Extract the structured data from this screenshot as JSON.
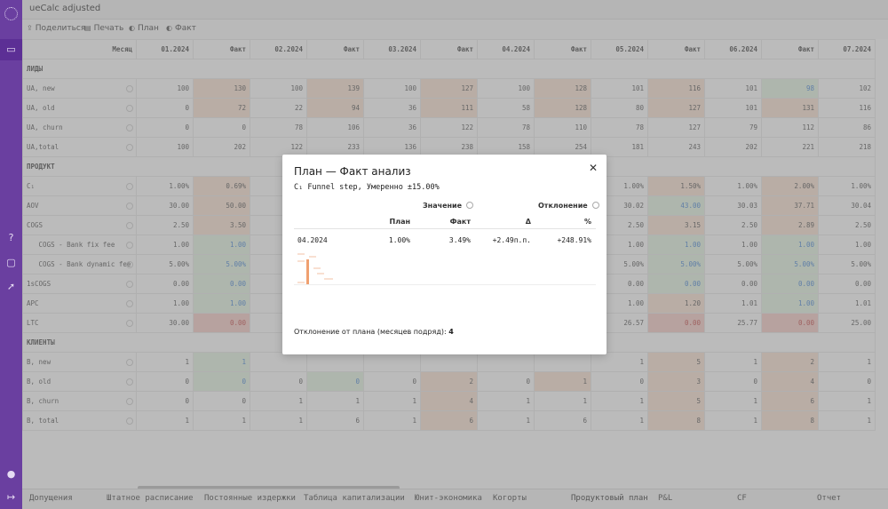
{
  "app": {
    "title": "ueCalc adjusted"
  },
  "toolbar": {
    "share": "Поделиться",
    "print": "Печать",
    "plan": "План",
    "fact": "Факт"
  },
  "grid": {
    "header": [
      "Месяц",
      "01.2024",
      "Факт",
      "02.2024",
      "Факт",
      "03.2024",
      "Факт",
      "04.2024",
      "Факт",
      "05.2024",
      "Факт",
      "06.2024",
      "Факт",
      "07.2024"
    ],
    "rows": [
      {
        "type": "section",
        "label": "ЛИДЫ"
      },
      {
        "label": "UA, new",
        "cells": [
          "100",
          "130",
          "100",
          "139",
          "100",
          "127",
          "100",
          "128",
          "101",
          "116",
          "101",
          "98",
          "102"
        ]
      },
      {
        "label": "UA, old",
        "cells": [
          "0",
          "72",
          "22",
          "94",
          "36",
          "111",
          "58",
          "128",
          "80",
          "127",
          "101",
          "131",
          "116"
        ]
      },
      {
        "label": "UA, churn",
        "cells": [
          "0",
          "0",
          "78",
          "106",
          "36",
          "122",
          "78",
          "110",
          "78",
          "127",
          "79",
          "112",
          "86"
        ]
      },
      {
        "label": "UA,total",
        "cells": [
          "100",
          "202",
          "122",
          "233",
          "136",
          "238",
          "158",
          "254",
          "181",
          "243",
          "202",
          "221",
          "218"
        ]
      },
      {
        "type": "section",
        "label": "ПРОДУКТ"
      },
      {
        "label": "C₁",
        "cells": [
          "1.00%",
          "0.69%",
          "",
          "",
          "",
          "",
          "",
          "",
          "1.00%",
          "1.50%",
          "1.00%",
          "2.00%",
          "1.00%"
        ]
      },
      {
        "label": "AOV",
        "cells": [
          "30.00",
          "50.00",
          "",
          "",
          "",
          "",
          "",
          "",
          "30.02",
          "43.00",
          "30.03",
          "37.71",
          "30.04"
        ]
      },
      {
        "label": "COGS",
        "cells": [
          "2.50",
          "3.50",
          "",
          "",
          "",
          "",
          "",
          "",
          "2.50",
          "3.15",
          "2.50",
          "2.89",
          "2.50"
        ]
      },
      {
        "label": "   COGS - Bank fix fee",
        "cells": [
          "1.00",
          "1.00",
          "",
          "",
          "",
          "",
          "",
          "",
          "1.00",
          "1.00",
          "1.00",
          "1.00",
          "1.00"
        ]
      },
      {
        "label": "   COGS - Bank dynamic fee",
        "cells": [
          "5.00%",
          "5.00%",
          "",
          "",
          "",
          "",
          "",
          "",
          "5.00%",
          "5.00%",
          "5.00%",
          "5.00%",
          "5.00%"
        ]
      },
      {
        "label": "1sCOGS",
        "cells": [
          "0.00",
          "0.00",
          "",
          "",
          "",
          "",
          "",
          "",
          "0.00",
          "0.00",
          "0.00",
          "0.00",
          "0.00"
        ]
      },
      {
        "label": "APC",
        "cells": [
          "1.00",
          "1.00",
          "",
          "",
          "",
          "",
          "",
          "",
          "1.00",
          "1.20",
          "1.01",
          "1.00",
          "1.01"
        ]
      },
      {
        "label": "LTC",
        "cells": [
          "30.00",
          "0.00",
          "",
          "",
          "",
          "",
          "",
          "",
          "26.57",
          "0.00",
          "25.77",
          "0.00",
          "25.00"
        ]
      },
      {
        "type": "section",
        "label": "КЛИЕНТЫ"
      },
      {
        "label": "B, new",
        "cells": [
          "1",
          "1",
          "",
          "",
          "",
          "",
          "",
          "",
          "1",
          "5",
          "1",
          "2",
          "1"
        ]
      },
      {
        "label": "B, old",
        "cells": [
          "0",
          "0",
          "0",
          "0",
          "0",
          "2",
          "0",
          "1",
          "0",
          "3",
          "0",
          "4",
          "0"
        ]
      },
      {
        "label": "B, churn",
        "cells": [
          "0",
          "0",
          "1",
          "1",
          "1",
          "4",
          "1",
          "1",
          "1",
          "5",
          "1",
          "6",
          "1"
        ]
      },
      {
        "label": "B, total",
        "cells": [
          "1",
          "1",
          "1",
          "6",
          "1",
          "6",
          "1",
          "6",
          "1",
          "8",
          "1",
          "8",
          "1"
        ]
      }
    ]
  },
  "modal": {
    "title": "План — Факт анализ",
    "subtitle": "C₁ Funnel step, Умеренно ±15.00%",
    "group_value": "Значение",
    "group_deviation": "Отклонение",
    "col_plan": "План",
    "col_fact": "Факт",
    "col_delta": "Δ",
    "col_pct": "%",
    "row": {
      "month": "04.2024",
      "plan": "1.00%",
      "fact": "3.49%",
      "delta": "+2.49п.п.",
      "pct": "+248.91%"
    },
    "footer_label": "Отклонение от плана (месяцев подряд):",
    "footer_value": "4"
  },
  "bottom_tabs": [
    "Допущения",
    "Штатное расписание",
    "Постоянные издержки",
    "Таблица капитализации",
    "Юнит-экономика",
    "Когорты",
    "Продуктовый план",
    "P&L",
    "CF",
    "Отчет"
  ],
  "colors": {
    "sidebar": "#6a3fa0",
    "green_cell": "#e4f5e3",
    "orange_cell": "#fbe3d3",
    "red_cell": "#f6cdc6",
    "spark_bar": "#f0a070"
  }
}
